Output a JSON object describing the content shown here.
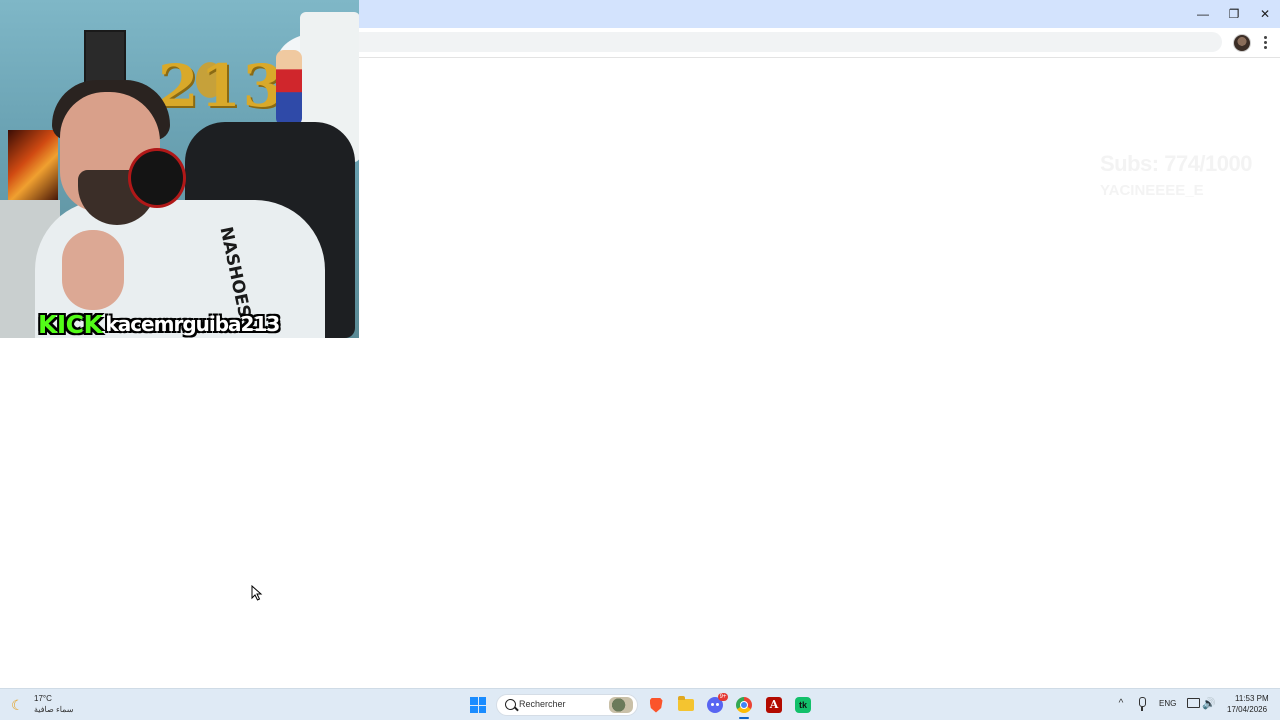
{
  "browser": {
    "window_controls": {
      "minimize": "—",
      "maximize": "❐",
      "close": "✕"
    },
    "omnibox_value": ""
  },
  "webcam": {
    "balloons_text": "213",
    "shirt_text": "NASHOES",
    "platform": "KICK",
    "username": "kacemrguiba213"
  },
  "overlay": {
    "sub_goal": "Subs: 774/1000",
    "sub_name": "YACINEEEE_E"
  },
  "taskbar": {
    "weather": {
      "icon": "moon-cloud-icon",
      "temperature": "17°C",
      "description": "سماء صافية"
    },
    "search_placeholder": "Rechercher",
    "apps": [
      {
        "name": "brave",
        "icon": "brave-icon"
      },
      {
        "name": "file-explorer",
        "icon": "folder-icon"
      },
      {
        "name": "discord",
        "icon": "discord-icon",
        "badge": "9+"
      },
      {
        "name": "chrome",
        "icon": "chrome-icon",
        "active": true
      },
      {
        "name": "acrobat",
        "icon": "acrobat-icon",
        "glyph": "A"
      },
      {
        "name": "app-green",
        "icon": "green-app-icon",
        "glyph": "tk"
      }
    ],
    "tray": {
      "chevron": "^",
      "language": "ENG",
      "volume": "🔊",
      "time": "11:53 PM",
      "date": "17/04/2026"
    }
  }
}
